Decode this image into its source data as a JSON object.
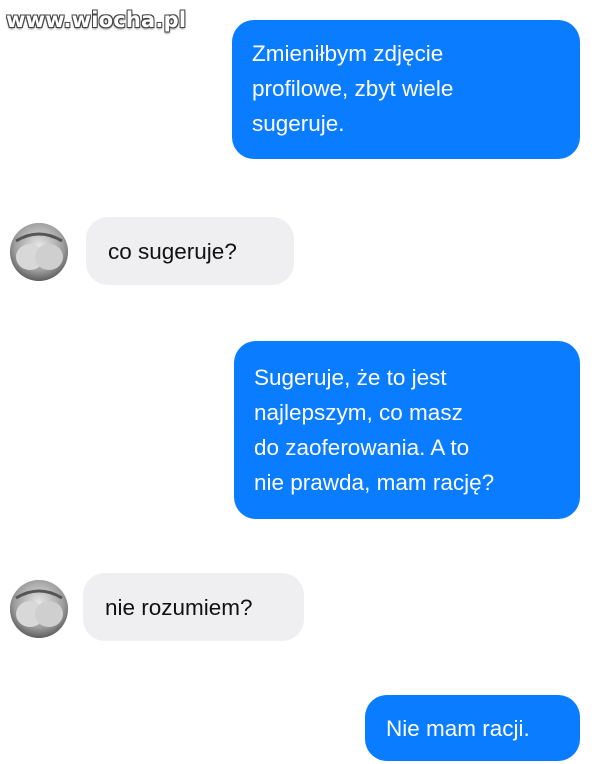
{
  "watermark": "www.wiocha.pl",
  "messages": [
    {
      "direction": "sent",
      "lines": [
        "Zmieniłbym zdjęcie",
        "profilowe, zbyt wiele",
        "sugeruje."
      ]
    },
    {
      "direction": "received",
      "avatar_icon": "profile-photo",
      "lines": [
        "co sugeruje?"
      ]
    },
    {
      "direction": "sent",
      "lines": [
        "Sugeruje, że to jest",
        "najlepszym, co masz",
        "do zaoferowania. A to",
        "nie prawda, mam rację?"
      ]
    },
    {
      "direction": "received",
      "avatar_icon": "profile-photo",
      "lines": [
        "nie rozumiem?"
      ]
    },
    {
      "direction": "sent",
      "lines": [
        "Nie mam racji."
      ]
    }
  ],
  "colors": {
    "sent_bubble": "#0a7cff",
    "received_bubble": "#efeff2",
    "sent_text": "#ffffff",
    "received_text": "#111111"
  }
}
